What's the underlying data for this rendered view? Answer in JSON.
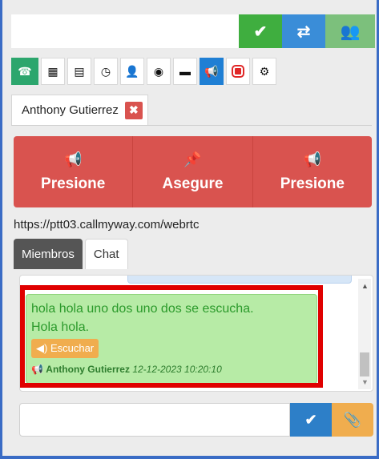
{
  "topbar": {
    "input_value": "",
    "buttons": [
      {
        "icon": "check-icon",
        "glyph": "✔"
      },
      {
        "icon": "swap-icon",
        "glyph": "⇄"
      },
      {
        "icon": "group-icon",
        "glyph": "👥"
      }
    ]
  },
  "toolbar": {
    "items": [
      {
        "icon": "phone-icon",
        "glyph": "☎"
      },
      {
        "icon": "grid-icon",
        "glyph": "▦"
      },
      {
        "icon": "list-icon",
        "glyph": "▤"
      },
      {
        "icon": "clock-icon",
        "glyph": "◷"
      },
      {
        "icon": "user-icon",
        "glyph": "👤"
      },
      {
        "icon": "globe-icon",
        "glyph": "◉"
      },
      {
        "icon": "comment-icon",
        "glyph": "▬"
      },
      {
        "icon": "megaphone-icon",
        "glyph": "📢"
      },
      {
        "icon": "record-icon",
        "glyph": ""
      },
      {
        "icon": "gear-icon",
        "glyph": "⚙"
      }
    ]
  },
  "user_tab": {
    "name": "Anthony Gutierrez",
    "close_glyph": "✖"
  },
  "actions": [
    {
      "icon": "megaphone-icon",
      "glyph": "📢",
      "label": "Presione"
    },
    {
      "icon": "pin-icon",
      "glyph": "📌",
      "label": "Asegure"
    },
    {
      "icon": "megaphone-icon",
      "glyph": "📢",
      "label": "Presione"
    }
  ],
  "url": "https://ptt03.callmyway.com/webrtc",
  "tabs": [
    {
      "label": "Miembros"
    },
    {
      "label": "Chat"
    }
  ],
  "message": {
    "text_line1": "hola hola uno dos uno dos se escucha.",
    "text_line2": "Hola hola.",
    "listen_label": "◀) Escuchar",
    "sender": "Anthony Gutierrez",
    "timestamp": "12-12-2023 10:20:10"
  },
  "bottom": {
    "input_value": "",
    "send_glyph": "✔",
    "attach_glyph": "📎"
  },
  "colors": {
    "accent_red": "#d9534f",
    "green": "#3fae3f",
    "blue": "#2d7fc8",
    "orange": "#f0ad4e",
    "highlight": "#e00000"
  }
}
